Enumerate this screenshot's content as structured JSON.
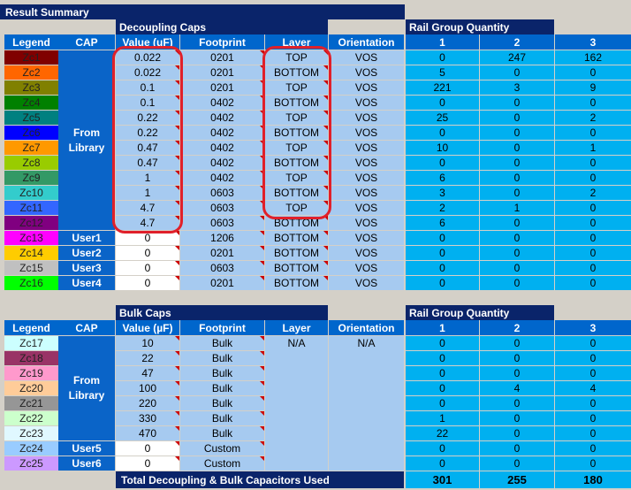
{
  "title": "Result Summary",
  "top_section": {
    "group_label": "Decoupling Caps",
    "rail_group_label": "Rail Group Quantity",
    "headers": {
      "legend": "Legend",
      "cap": "CAP",
      "value": "Value (uF)",
      "footprint": "Footprint",
      "layer": "Layer",
      "orientation": "Orientation",
      "rail1": "1",
      "rail2": "2",
      "rail3": "3"
    },
    "from_library": "From\nLibrary",
    "rows": [
      {
        "legend": "Zc1",
        "color": "#800000",
        "value": "0.022",
        "footprint": "0201",
        "layer": "TOP",
        "orientation": "VOS",
        "r1": "0",
        "r2": "247",
        "r3": "162"
      },
      {
        "legend": "Zc2",
        "color": "#ff6600",
        "value": "0.022",
        "footprint": "0201",
        "layer": "BOTTOM",
        "orientation": "VOS",
        "r1": "5",
        "r2": "0",
        "r3": "0"
      },
      {
        "legend": "Zc3",
        "color": "#808000",
        "value": "0.1",
        "footprint": "0201",
        "layer": "TOP",
        "orientation": "VOS",
        "r1": "221",
        "r2": "3",
        "r3": "9"
      },
      {
        "legend": "Zc4",
        "color": "#008000",
        "value": "0.1",
        "footprint": "0402",
        "layer": "BOTTOM",
        "orientation": "VOS",
        "r1": "0",
        "r2": "0",
        "r3": "0"
      },
      {
        "legend": "Zc5",
        "color": "#008080",
        "value": "0.22",
        "footprint": "0402",
        "layer": "TOP",
        "orientation": "VOS",
        "r1": "25",
        "r2": "0",
        "r3": "2"
      },
      {
        "legend": "Zc6",
        "color": "#0000ff",
        "value": "0.22",
        "footprint": "0402",
        "layer": "BOTTOM",
        "orientation": "VOS",
        "r1": "0",
        "r2": "0",
        "r3": "0"
      },
      {
        "legend": "Zc7",
        "color": "#ff9900",
        "value": "0.47",
        "footprint": "0402",
        "layer": "TOP",
        "orientation": "VOS",
        "r1": "10",
        "r2": "0",
        "r3": "1"
      },
      {
        "legend": "Zc8",
        "color": "#99cc00",
        "value": "0.47",
        "footprint": "0402",
        "layer": "BOTTOM",
        "orientation": "VOS",
        "r1": "0",
        "r2": "0",
        "r3": "0"
      },
      {
        "legend": "Zc9",
        "color": "#339966",
        "value": "1",
        "footprint": "0402",
        "layer": "TOP",
        "orientation": "VOS",
        "r1": "6",
        "r2": "0",
        "r3": "0"
      },
      {
        "legend": "Zc10",
        "color": "#33cccc",
        "value": "1",
        "footprint": "0603",
        "layer": "BOTTOM",
        "orientation": "VOS",
        "r1": "3",
        "r2": "0",
        "r3": "2"
      },
      {
        "legend": "Zc11",
        "color": "#3366ff",
        "value": "4.7",
        "footprint": "0603",
        "layer": "TOP",
        "orientation": "VOS",
        "r1": "2",
        "r2": "1",
        "r3": "0"
      },
      {
        "legend": "Zc12",
        "color": "#800080",
        "value": "4.7",
        "footprint": "0603",
        "layer": "BOTTOM",
        "orientation": "VOS",
        "r1": "6",
        "r2": "0",
        "r3": "0"
      },
      {
        "legend": "Zc13",
        "color": "#ff00ff",
        "cap": "User1",
        "value": "0",
        "footprint": "1206",
        "layer": "BOTTOM",
        "orientation": "VOS",
        "r1": "0",
        "r2": "0",
        "r3": "0"
      },
      {
        "legend": "Zc14",
        "color": "#ffcc00",
        "cap": "User2",
        "value": "0",
        "footprint": "0201",
        "layer": "BOTTOM",
        "orientation": "VOS",
        "r1": "0",
        "r2": "0",
        "r3": "0"
      },
      {
        "legend": "Zc15",
        "color": "#c0c0c0",
        "cap": "User3",
        "value": "0",
        "footprint": "0603",
        "layer": "BOTTOM",
        "orientation": "VOS",
        "r1": "0",
        "r2": "0",
        "r3": "0"
      },
      {
        "legend": "Zc16",
        "color": "#00ff00",
        "cap": "User4",
        "value": "0",
        "footprint": "0201",
        "layer": "BOTTOM",
        "orientation": "VOS",
        "r1": "0",
        "r2": "0",
        "r3": "0"
      }
    ]
  },
  "bottom_section": {
    "group_label": "Bulk Caps",
    "rail_group_label": "Rail Group Quantity",
    "headers": {
      "legend": "Legend",
      "cap": "CAP",
      "value": "Value (µF)",
      "footprint": "Footprint",
      "layer": "Layer",
      "orientation": "Orientation",
      "rail1": "1",
      "rail2": "2",
      "rail3": "3"
    },
    "from_library": "From\nLibrary",
    "layer_value": "N/A",
    "orientation_value": "N/A",
    "rows": [
      {
        "legend": "Zc17",
        "color": "#ccffff",
        "value": "10",
        "footprint": "Bulk",
        "r1": "0",
        "r2": "0",
        "r3": "0"
      },
      {
        "legend": "Zc18",
        "color": "#993366",
        "value": "22",
        "footprint": "Bulk",
        "r1": "0",
        "r2": "0",
        "r3": "0"
      },
      {
        "legend": "Zc19",
        "color": "#ff99cc",
        "value": "47",
        "footprint": "Bulk",
        "r1": "0",
        "r2": "0",
        "r3": "0"
      },
      {
        "legend": "Zc20",
        "color": "#ffcc99",
        "value": "100",
        "footprint": "Bulk",
        "r1": "0",
        "r2": "4",
        "r3": "4"
      },
      {
        "legend": "Zc21",
        "color": "#969696",
        "value": "220",
        "footprint": "Bulk",
        "r1": "0",
        "r2": "0",
        "r3": "0"
      },
      {
        "legend": "Zc22",
        "color": "#ccffcc",
        "value": "330",
        "footprint": "Bulk",
        "r1": "1",
        "r2": "0",
        "r3": "0"
      },
      {
        "legend": "Zc23",
        "color": "#e0f8ff",
        "value": "470",
        "footprint": "Bulk",
        "r1": "22",
        "r2": "0",
        "r3": "0"
      },
      {
        "legend": "Zc24",
        "color": "#99ccff",
        "cap": "User5",
        "value": "0",
        "footprint": "Custom",
        "r1": "0",
        "r2": "0",
        "r3": "0"
      },
      {
        "legend": "Zc25",
        "color": "#cc99ff",
        "cap": "User6",
        "value": "0",
        "footprint": "Custom",
        "r1": "0",
        "r2": "0",
        "r3": "0"
      }
    ],
    "total_label": "Total Decoupling & Bulk Capacitors Used",
    "totals": {
      "r1": "301",
      "r2": "255",
      "r3": "180"
    }
  }
}
